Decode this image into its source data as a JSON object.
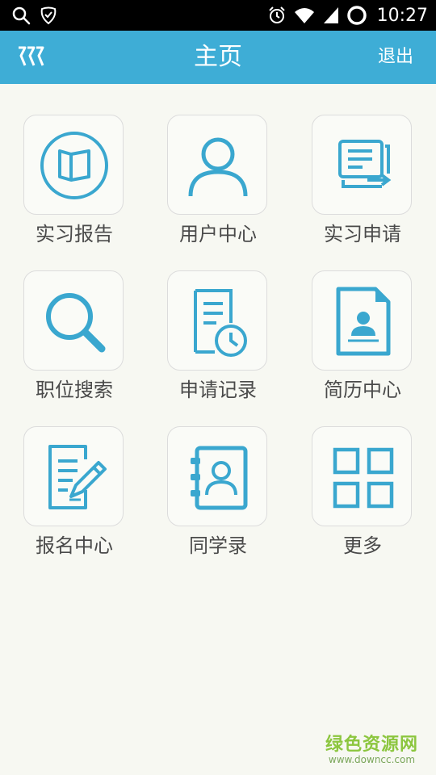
{
  "status_bar": {
    "time": "10:27",
    "icons": [
      "search-icon",
      "notification-icon",
      "alarm-icon",
      "wifi-icon",
      "signal-icon",
      "battery-icon"
    ]
  },
  "app_bar": {
    "title": "主页",
    "logout_label": "退出",
    "logo_icon": "app-logo-icon"
  },
  "grid": {
    "items": [
      {
        "label": "实习报告",
        "icon": "book-circle-icon"
      },
      {
        "label": "用户中心",
        "icon": "user-icon"
      },
      {
        "label": "实习申请",
        "icon": "document-arrow-icon"
      },
      {
        "label": "职位搜索",
        "icon": "search-icon"
      },
      {
        "label": "申请记录",
        "icon": "document-clock-icon"
      },
      {
        "label": "简历中心",
        "icon": "resume-icon"
      },
      {
        "label": "报名中心",
        "icon": "document-pen-icon"
      },
      {
        "label": "同学录",
        "icon": "contact-book-icon"
      },
      {
        "label": "更多",
        "icon": "grid-icon"
      }
    ]
  },
  "watermark": {
    "main": "绿色资源网",
    "sub": "www.downcc.com"
  },
  "colors": {
    "accent": "#3eadd6",
    "icon": "#3aa7cf",
    "background": "#f7f8f2",
    "label": "#4a4a4a"
  }
}
